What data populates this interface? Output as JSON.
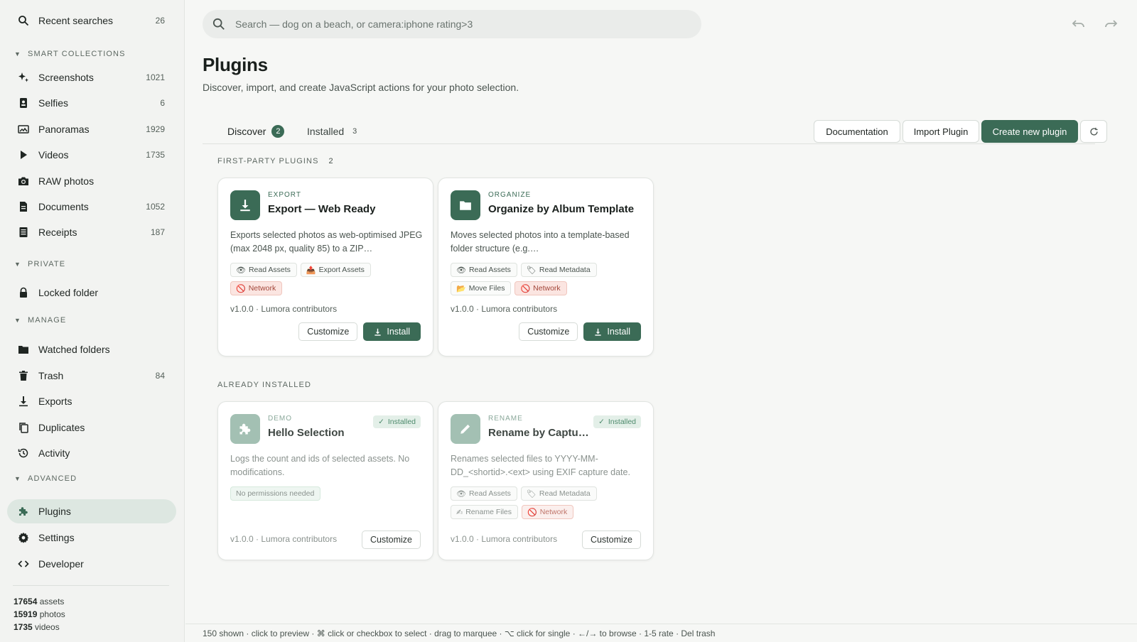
{
  "sidebar": {
    "recent": {
      "label": "Recent searches",
      "count": "26"
    },
    "sections": {
      "smart": "SMART COLLECTIONS",
      "private": "PRIVATE",
      "manage": "MANAGE",
      "advanced": "ADVANCED"
    },
    "smart_items": [
      {
        "label": "Screenshots",
        "count": "1021",
        "icon": "sparkle-icon"
      },
      {
        "label": "Selfies",
        "count": "6",
        "icon": "phone-portrait-icon"
      },
      {
        "label": "Panoramas",
        "count": "1929",
        "icon": "panorama-icon"
      },
      {
        "label": "Videos",
        "count": "1735",
        "icon": "play-icon"
      },
      {
        "label": "RAW photos",
        "count": "",
        "icon": "camera-icon"
      },
      {
        "label": "Documents",
        "count": "1052",
        "icon": "document-icon"
      },
      {
        "label": "Receipts",
        "count": "187",
        "icon": "receipt-icon"
      }
    ],
    "private_items": [
      {
        "label": "Locked folder",
        "icon": "lock-icon"
      }
    ],
    "manage_items": [
      {
        "label": "Watched folders",
        "count": "",
        "icon": "folder-icon"
      },
      {
        "label": "Trash",
        "count": "84",
        "icon": "trash-icon"
      },
      {
        "label": "Exports",
        "count": "",
        "icon": "download-icon"
      },
      {
        "label": "Duplicates",
        "count": "",
        "icon": "copy-icon"
      },
      {
        "label": "Activity",
        "count": "",
        "icon": "history-icon"
      }
    ],
    "advanced_items": [
      {
        "label": "Plugins",
        "icon": "puzzle-icon",
        "active": true
      },
      {
        "label": "Settings",
        "icon": "gear-icon"
      },
      {
        "label": "Developer",
        "icon": "code-icon"
      }
    ],
    "stats": {
      "assets_num": "17654",
      "assets_label": "assets",
      "photos_num": "15919",
      "photos_label": "photos",
      "videos_num": "1735",
      "videos_label": "videos"
    }
  },
  "search": {
    "placeholder": "Search — dog on a beach, or camera:iphone rating>3"
  },
  "page": {
    "title": "Plugins",
    "subtitle": "Discover, import, and create JavaScript actions for your photo selection."
  },
  "tabs": {
    "discover": {
      "label": "Discover",
      "badge": "2"
    },
    "installed": {
      "label": "Installed",
      "count": "3"
    }
  },
  "toolbar": {
    "docs": "Documentation",
    "import": "Import Plugin",
    "create": "Create new plugin"
  },
  "groups": {
    "first_party": {
      "label": "FIRST-PARTY PLUGINS",
      "count": "2"
    },
    "installed": {
      "label": "ALREADY INSTALLED"
    }
  },
  "cards": {
    "export": {
      "category": "EXPORT",
      "name": "Export — Web Ready",
      "desc": "Exports selected photos as web-optimised JPEG (max 2048 px, quality 85) to a ZIP…",
      "perms": [
        "Read Assets",
        "Export Assets",
        "Network"
      ],
      "meta": "v1.0.0 · Lumora contributors",
      "customize": "Customize",
      "install": "Install"
    },
    "organize": {
      "category": "ORGANIZE",
      "name": "Organize by Album Template",
      "desc": "Moves selected photos into a template-based folder structure (e.g.…",
      "perms": [
        "Read Assets",
        "Read Metadata",
        "Move Files",
        "Network"
      ],
      "meta": "v1.0.0 · Lumora contributors",
      "customize": "Customize",
      "install": "Install"
    },
    "hello": {
      "category": "DEMO",
      "name": "Hello Selection",
      "badge": "Installed",
      "desc": "Logs the count and ids of selected assets. No modifications.",
      "perms": [
        "No permissions needed"
      ],
      "meta": "v1.0.0 · Lumora contributors",
      "customize": "Customize"
    },
    "rename": {
      "category": "RENAME",
      "name": "Rename by Captu…",
      "badge": "Installed",
      "desc": "Renames selected files to YYYY-MM-DD_<shortid>.<ext> using EXIF capture date.",
      "perms": [
        "Read Assets",
        "Read Metadata",
        "Rename Files",
        "Network"
      ],
      "meta": "v1.0.0 · Lumora contributors",
      "customize": "Customize"
    }
  },
  "statusbar": "150 shown · click to preview · ⌘ click or checkbox to select · drag to marquee · ⌥ click for single · ←/→ to browse · 1-5 rate · Del trash",
  "colors": {
    "accent": "#3b6b56",
    "active_bg": "#dde7e1",
    "danger": "#a3473a"
  }
}
